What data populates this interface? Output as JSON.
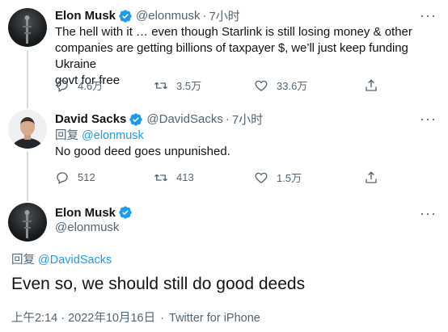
{
  "tweet1": {
    "name": "Elon Musk",
    "handle": "@elonmusk",
    "dot": "·",
    "time": "7小时",
    "text_lines": [
      "The hell with it … even though Starlink is still losing money & other",
      "companies are getting billions of taxpayer $, we’ll just keep funding Ukraine",
      "govt for free"
    ],
    "replies": "4.6万",
    "retweets": "3.5万",
    "likes": "33.6万"
  },
  "tweet2": {
    "name": "David Sacks",
    "handle": "@DavidSacks",
    "dot": "·",
    "time": "7小时",
    "reply_prefix": "回复",
    "reply_handle": "@elonmusk",
    "text": "No good deed goes unpunished.",
    "replies": "512",
    "retweets": "413",
    "likes": "1.5万"
  },
  "tweet3": {
    "name": "Elon Musk",
    "handle": "@elonmusk",
    "reply_prefix": "回复",
    "reply_handle": "@DavidSacks",
    "text": "Even so, we should still do good deeds",
    "timestamp": "上午2:14 · 2022年10月16日",
    "dot": "·",
    "source": "Twitter for iPhone"
  },
  "more_label": "···",
  "colors": {
    "verified": "#1d9bf0",
    "link": "#1d9bf0",
    "muted": "#536471"
  }
}
